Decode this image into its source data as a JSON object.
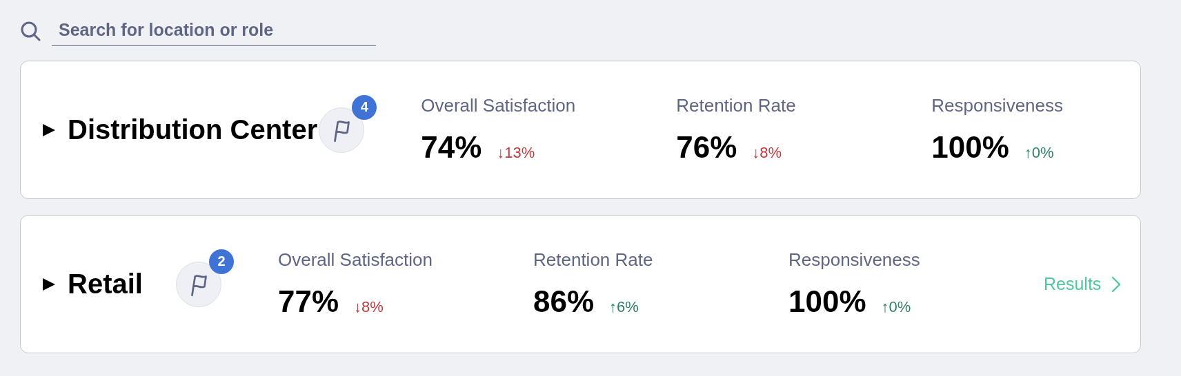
{
  "search": {
    "placeholder": "Search for location or role"
  },
  "groups": [
    {
      "title": "Distribution Center",
      "expanded": false,
      "flag_count": "4",
      "metrics": [
        {
          "label": "Overall Satisfaction",
          "value": "74%",
          "change": "↓13%",
          "kind": "down"
        },
        {
          "label": "Retention Rate",
          "value": "76%",
          "change": "↓8%",
          "kind": "down"
        },
        {
          "label": "Responsiveness",
          "value": "100%",
          "change": "↑0%",
          "kind": "up"
        }
      ]
    },
    {
      "title": "Retail",
      "expanded": false,
      "flag_count": "2",
      "metrics": [
        {
          "label": "Overall Satisfaction",
          "value": "77%",
          "change": "↓8%",
          "kind": "down"
        },
        {
          "label": "Retention Rate",
          "value": "86%",
          "change": "↑6%",
          "kind": "up"
        },
        {
          "label": "Responsiveness",
          "value": "100%",
          "change": "↑0%",
          "kind": "up"
        }
      ],
      "link": "Results"
    }
  ]
}
